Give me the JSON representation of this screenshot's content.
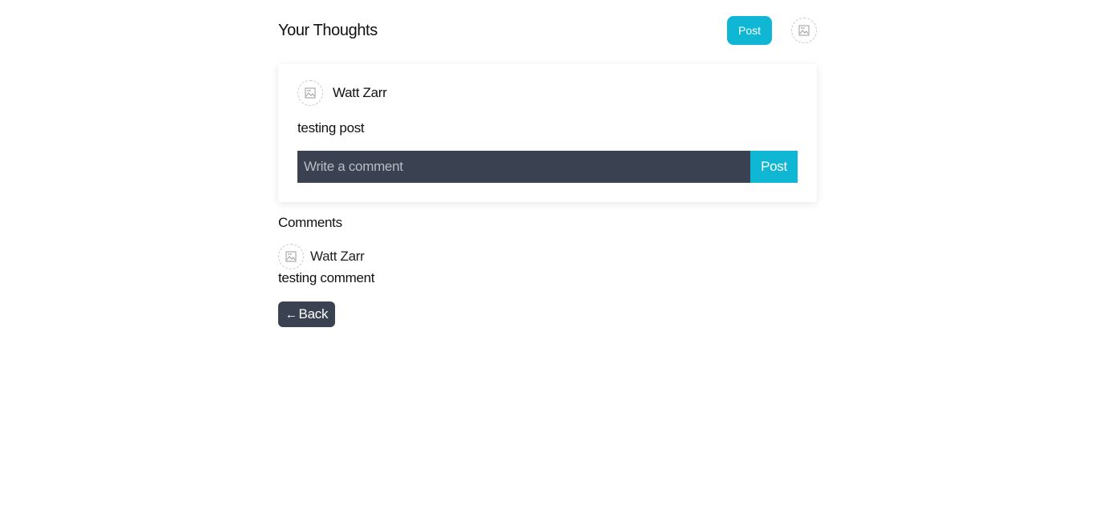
{
  "header": {
    "title": "Your Thoughts",
    "post_button_label": "Post",
    "avatar_icon": "broken-image-icon"
  },
  "post": {
    "author": "Watt Zarr",
    "body": "testing post",
    "avatar_icon": "broken-image-icon",
    "comment_form": {
      "placeholder": "Write a comment",
      "value": "",
      "post_button_label": "Post"
    }
  },
  "comments": {
    "heading": "Comments",
    "items": [
      {
        "author": "Watt Zarr",
        "body": "testing comment",
        "avatar_icon": "broken-image-icon"
      }
    ]
  },
  "back_button": {
    "icon": "arrow-left-icon",
    "icon_glyph": "←",
    "label": "Back"
  },
  "colors": {
    "accent": "#0fb7d4",
    "dark": "#3a4150",
    "text": "#111111"
  }
}
